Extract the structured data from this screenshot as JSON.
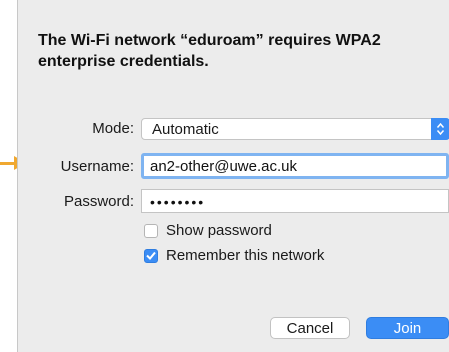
{
  "dialog": {
    "title": "The Wi-Fi network “eduroam” requires WPA2 enterprise credentials."
  },
  "form": {
    "mode_label": "Mode:",
    "mode_value": "Automatic",
    "username_label": "Username:",
    "username_value": "an2-other@uwe.ac.uk",
    "password_label": "Password:",
    "password_value": "••••••••",
    "show_password_label": "Show password",
    "show_password_checked": false,
    "remember_label": "Remember this network",
    "remember_checked": true
  },
  "buttons": {
    "cancel_label": "Cancel",
    "join_label": "Join"
  },
  "colors": {
    "accent": "#3b8df5",
    "focus_ring": "#7fb4f1",
    "annotation_arrow": "#f0a830"
  }
}
